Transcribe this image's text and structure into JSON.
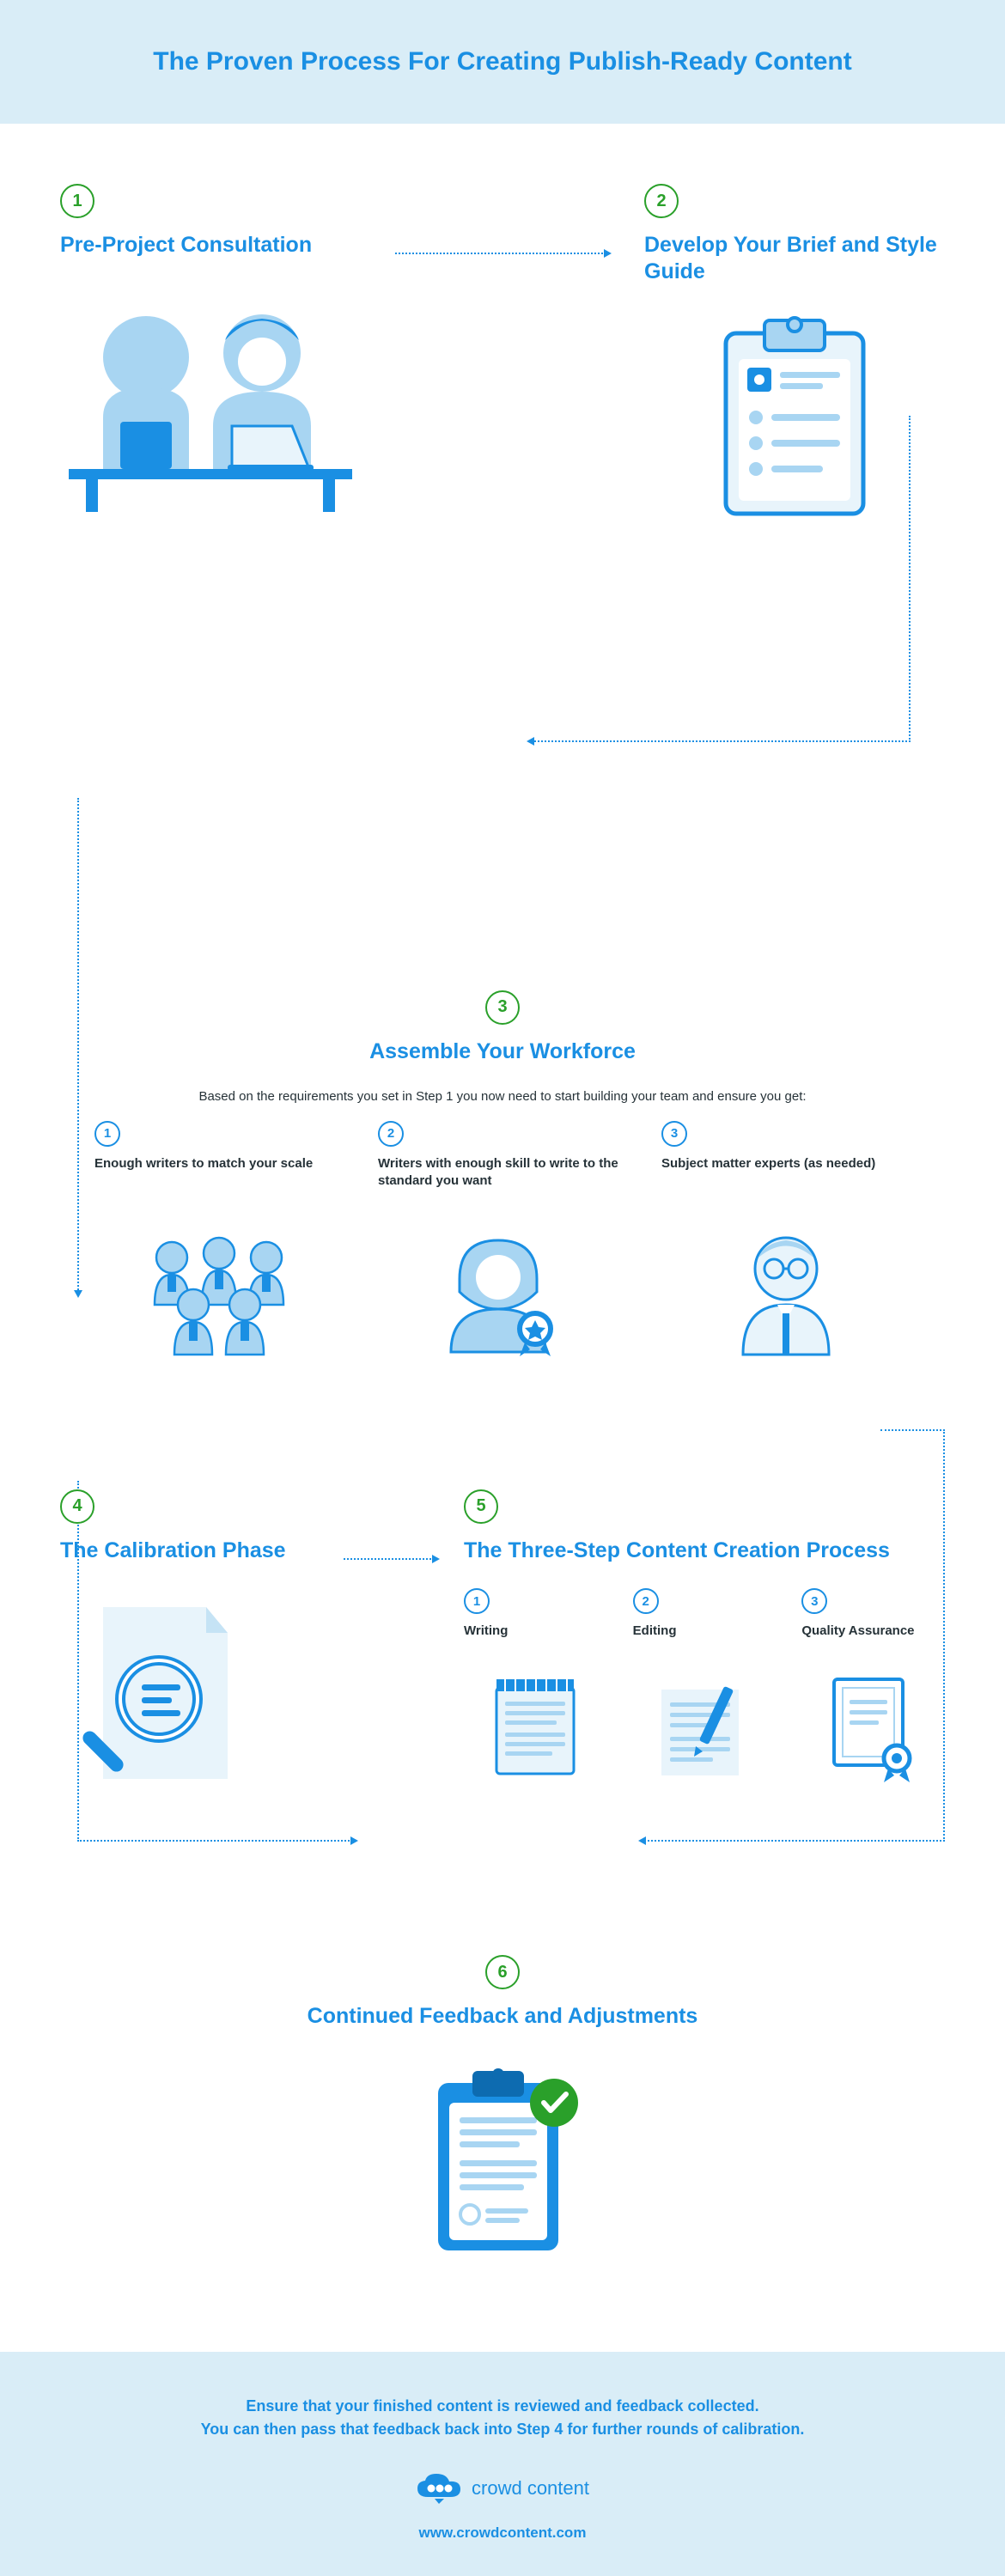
{
  "header": {
    "title": "The Proven Process For Creating Publish-Ready Content"
  },
  "steps": {
    "s1": {
      "num": "1",
      "title": "Pre-Project Consultation"
    },
    "s2": {
      "num": "2",
      "title": "Develop Your Brief and Style Guide"
    },
    "s3": {
      "num": "3",
      "title": "Assemble Your Workforce",
      "intro": "Based on the requirements you set in Step 1 you now need to start building your team and ensure you get:",
      "items": [
        {
          "num": "1",
          "text": "Enough writers to match your scale"
        },
        {
          "num": "2",
          "text": "Writers with enough skill to write to the standard you want"
        },
        {
          "num": "3",
          "text": "Subject matter experts (as needed)"
        }
      ]
    },
    "s4": {
      "num": "4",
      "title": "The Calibration Phase"
    },
    "s5": {
      "num": "5",
      "title": "The Three-Step Content Creation Process",
      "items": [
        {
          "num": "1",
          "text": "Writing"
        },
        {
          "num": "2",
          "text": "Editing"
        },
        {
          "num": "3",
          "text": "Quality Assurance"
        }
      ]
    },
    "s6": {
      "num": "6",
      "title": "Continued Feedback and Adjustments"
    }
  },
  "footer": {
    "line1": "Ensure that your finished content is reviewed and feedback collected.",
    "line2": "You can then pass that feedback back into Step 4 for further rounds of calibration.",
    "brand": "crowd content",
    "url": "www.crowdcontent.com"
  }
}
